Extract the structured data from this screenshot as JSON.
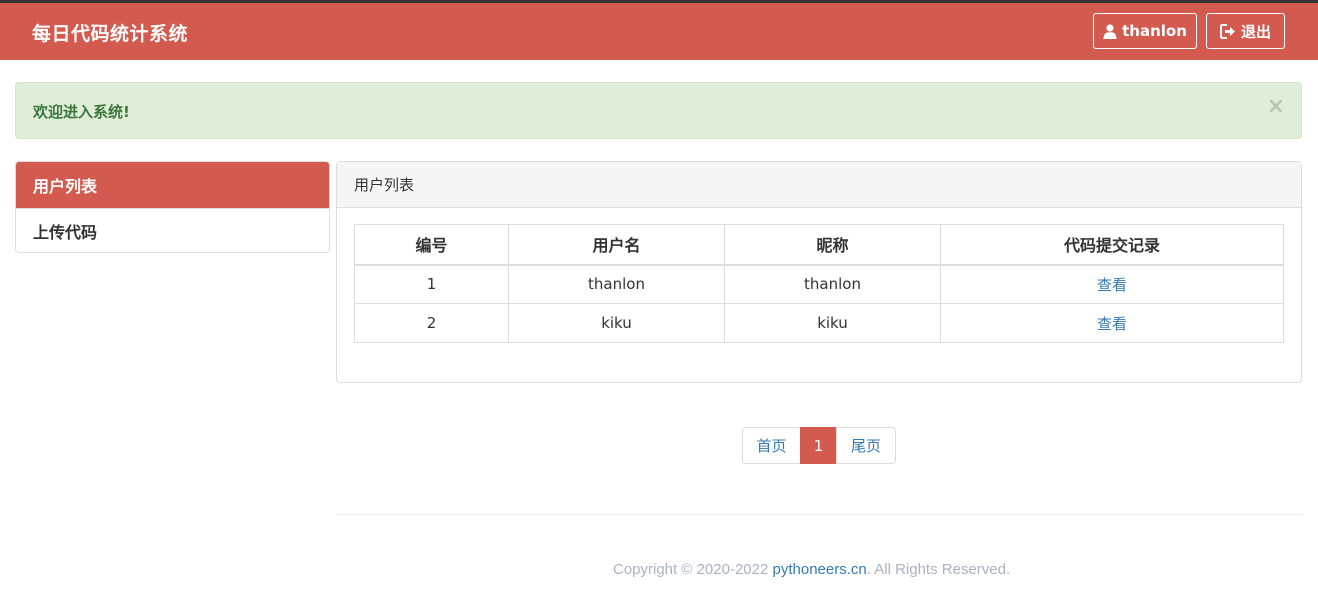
{
  "navbar": {
    "brand": "每日代码统计系统",
    "user_label": "thanlon",
    "logout_label": "退出"
  },
  "alert": {
    "message": "欢迎进入系统!",
    "close": "×"
  },
  "sidebar": {
    "items": [
      {
        "label": "用户列表",
        "active": true
      },
      {
        "label": "上传代码",
        "active": false
      }
    ]
  },
  "panel": {
    "title": "用户列表",
    "columns": [
      "编号",
      "用户名",
      "昵称",
      "代码提交记录"
    ],
    "rows": [
      {
        "id": "1",
        "username": "thanlon",
        "nickname": "thanlon",
        "action": "查看"
      },
      {
        "id": "2",
        "username": "kiku",
        "nickname": "kiku",
        "action": "查看"
      }
    ]
  },
  "pagination": {
    "first": "首页",
    "current": "1",
    "last": "尾页"
  },
  "footer": {
    "prefix": "Copyright © 2020-2022 ",
    "link": "pythoneers.cn",
    "suffix": ". All Rights Reserved."
  },
  "colors": {
    "brand": "#d35a4e",
    "link": "#337ab7",
    "success_bg": "#dfeed8",
    "success_text": "#3c763d"
  }
}
